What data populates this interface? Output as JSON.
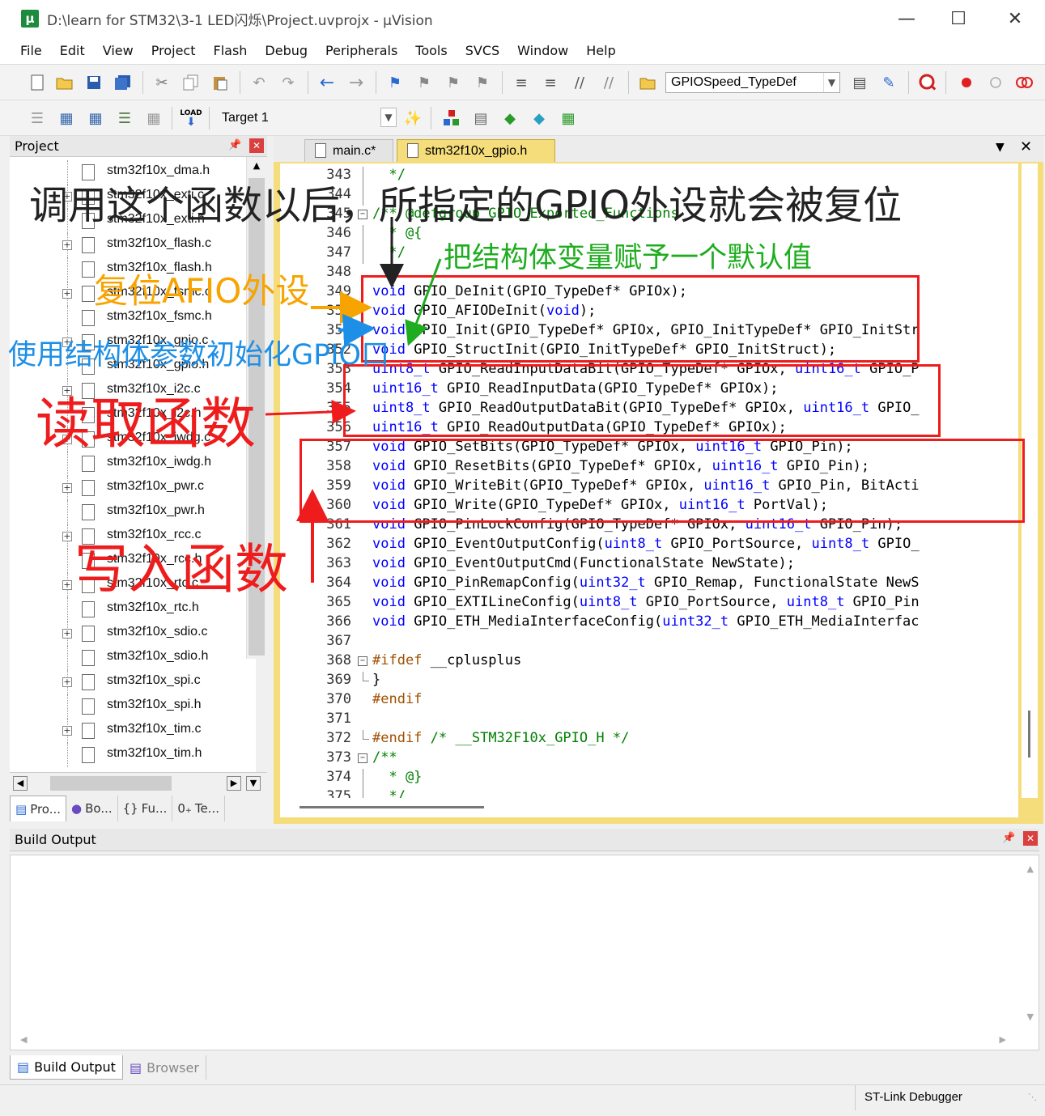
{
  "window": {
    "title": "D:\\learn for STM32\\3-1 LED闪烁\\Project.uvprojx - µVision",
    "app_icon": "µ"
  },
  "menu": [
    "File",
    "Edit",
    "View",
    "Project",
    "Flash",
    "Debug",
    "Peripherals",
    "Tools",
    "SVCS",
    "Window",
    "Help"
  ],
  "toolbar": {
    "find_combo_value": "GPIOSpeed_TypeDef",
    "target_combo_value": "Target 1",
    "load_label": "LOAD"
  },
  "project_panel": {
    "title": "Project",
    "files": [
      {
        "name": "stm32f10x_dma.h",
        "expandable": false
      },
      {
        "name": "stm32f10x_exti.c",
        "expandable": true
      },
      {
        "name": "stm32f10x_exti.h",
        "expandable": false
      },
      {
        "name": "stm32f10x_flash.c",
        "expandable": true
      },
      {
        "name": "stm32f10x_flash.h",
        "expandable": false
      },
      {
        "name": "stm32f10x_fsmc.c",
        "expandable": true
      },
      {
        "name": "stm32f10x_fsmc.h",
        "expandable": false
      },
      {
        "name": "stm32f10x_gpio.c",
        "expandable": true
      },
      {
        "name": "stm32f10x_gpio.h",
        "expandable": false
      },
      {
        "name": "stm32f10x_i2c.c",
        "expandable": true
      },
      {
        "name": "stm32f10x_i2c.h",
        "expandable": false
      },
      {
        "name": "stm32f10x_iwdg.c",
        "expandable": true
      },
      {
        "name": "stm32f10x_iwdg.h",
        "expandable": false
      },
      {
        "name": "stm32f10x_pwr.c",
        "expandable": true
      },
      {
        "name": "stm32f10x_pwr.h",
        "expandable": false
      },
      {
        "name": "stm32f10x_rcc.c",
        "expandable": true
      },
      {
        "name": "stm32f10x_rcc.h",
        "expandable": false
      },
      {
        "name": "stm32f10x_rtc.c",
        "expandable": true
      },
      {
        "name": "stm32f10x_rtc.h",
        "expandable": false
      },
      {
        "name": "stm32f10x_sdio.c",
        "expandable": true
      },
      {
        "name": "stm32f10x_sdio.h",
        "expandable": false
      },
      {
        "name": "stm32f10x_spi.c",
        "expandable": true
      },
      {
        "name": "stm32f10x_spi.h",
        "expandable": false
      },
      {
        "name": "stm32f10x_tim.c",
        "expandable": true
      },
      {
        "name": "stm32f10x_tim.h",
        "expandable": false
      }
    ],
    "tabs": [
      "Pro...",
      "Bo...",
      "Fu...",
      "Te..."
    ]
  },
  "editor": {
    "tabs": [
      {
        "label": "main.c*",
        "active": false
      },
      {
        "label": "stm32f10x_gpio.h",
        "active": true
      }
    ],
    "lines": [
      {
        "n": "343",
        "t": "  */",
        "fold": "line"
      },
      {
        "n": "344",
        "t": "",
        "fold": "line"
      },
      {
        "n": "345",
        "t": "/** @defgroup GPIO_Exported_Functions",
        "fold": "box"
      },
      {
        "n": "346",
        "t": "  * @{",
        "fold": "line"
      },
      {
        "n": "347",
        "t": "  */",
        "fold": "line"
      },
      {
        "n": "348",
        "t": "",
        "fold": "none"
      },
      {
        "n": "349",
        "t": "void GPIO_DeInit(GPIO_TypeDef* GPIOx);",
        "fold": "none"
      },
      {
        "n": "350",
        "t": "void GPIO_AFIODeInit(void);",
        "fold": "none"
      },
      {
        "n": "351",
        "t": "void GPIO_Init(GPIO_TypeDef* GPIOx, GPIO_InitTypeDef* GPIO_InitStr",
        "fold": "none"
      },
      {
        "n": "352",
        "t": "void GPIO_StructInit(GPIO_InitTypeDef* GPIO_InitStruct);",
        "fold": "none"
      },
      {
        "n": "353",
        "t": "uint8_t GPIO_ReadInputDataBit(GPIO_TypeDef* GPIOx, uint16_t GPIO_P",
        "fold": "none"
      },
      {
        "n": "354",
        "t": "uint16_t GPIO_ReadInputData(GPIO_TypeDef* GPIOx);",
        "fold": "none"
      },
      {
        "n": "355",
        "t": "uint8_t GPIO_ReadOutputDataBit(GPIO_TypeDef* GPIOx, uint16_t GPIO_",
        "fold": "none"
      },
      {
        "n": "356",
        "t": "uint16_t GPIO_ReadOutputData(GPIO_TypeDef* GPIOx);",
        "fold": "none"
      },
      {
        "n": "357",
        "t": "void GPIO_SetBits(GPIO_TypeDef* GPIOx, uint16_t GPIO_Pin);",
        "fold": "none"
      },
      {
        "n": "358",
        "t": "void GPIO_ResetBits(GPIO_TypeDef* GPIOx, uint16_t GPIO_Pin);",
        "fold": "none"
      },
      {
        "n": "359",
        "t": "void GPIO_WriteBit(GPIO_TypeDef* GPIOx, uint16_t GPIO_Pin, BitActi",
        "fold": "none"
      },
      {
        "n": "360",
        "t": "void GPIO_Write(GPIO_TypeDef* GPIOx, uint16_t PortVal);",
        "fold": "none"
      },
      {
        "n": "361",
        "t": "void GPIO_PinLockConfig(GPIO_TypeDef* GPIOx, uint16_t GPIO_Pin);",
        "fold": "none"
      },
      {
        "n": "362",
        "t": "void GPIO_EventOutputConfig(uint8_t GPIO_PortSource, uint8_t GPIO_",
        "fold": "none"
      },
      {
        "n": "363",
        "t": "void GPIO_EventOutputCmd(FunctionalState NewState);",
        "fold": "none"
      },
      {
        "n": "364",
        "t": "void GPIO_PinRemapConfig(uint32_t GPIO_Remap, FunctionalState NewS",
        "fold": "none"
      },
      {
        "n": "365",
        "t": "void GPIO_EXTILineConfig(uint8_t GPIO_PortSource, uint8_t GPIO_Pin",
        "fold": "none"
      },
      {
        "n": "366",
        "t": "void GPIO_ETH_MediaInterfaceConfig(uint32_t GPIO_ETH_MediaInterfac",
        "fold": "none"
      },
      {
        "n": "367",
        "t": "",
        "fold": "none"
      },
      {
        "n": "368",
        "t": "#ifdef __cplusplus",
        "fold": "box"
      },
      {
        "n": "369",
        "t": "}",
        "fold": "end"
      },
      {
        "n": "370",
        "t": "#endif",
        "fold": "none"
      },
      {
        "n": "371",
        "t": "",
        "fold": "none"
      },
      {
        "n": "372",
        "t": "#endif /* __STM32F10x_GPIO_H */",
        "fold": "end"
      },
      {
        "n": "373",
        "t": "/**",
        "fold": "box"
      },
      {
        "n": "374",
        "t": "  * @}",
        "fold": "line"
      },
      {
        "n": "375",
        "t": "  */",
        "fold": "line"
      }
    ]
  },
  "build_output": {
    "title": "Build Output",
    "tabs": [
      "Build Output",
      "Browser"
    ]
  },
  "status": {
    "debugger": "ST-Link Debugger"
  },
  "annotations": {
    "top_caption": "调用这个函数以后，所指定的GPIO外设就会被复位",
    "struct_default": "把结构体变量赋予一个默认值",
    "afio_reset": "复位AFIO外设",
    "init_with_struct": "使用结构体参数初始化GPIO口",
    "read_funcs": "读取函数",
    "write_funcs": "写入函数",
    "colors": {
      "red": "#ee1c1c",
      "green": "#1fad1f",
      "orange": "#f7a400",
      "blue": "#1e8fe6",
      "black": "#222222"
    }
  }
}
